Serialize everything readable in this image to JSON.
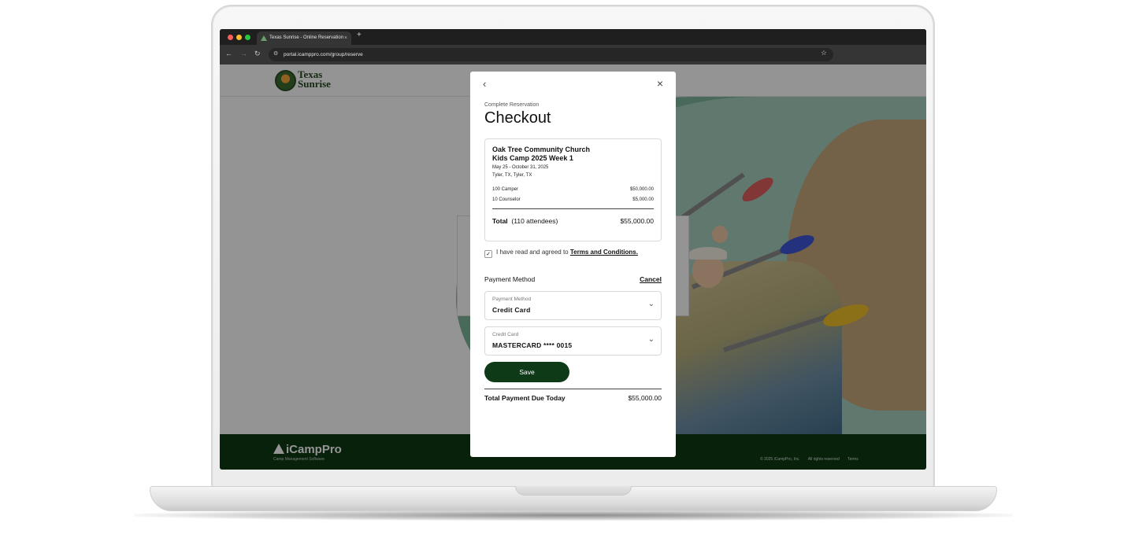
{
  "browser": {
    "tab_title": "Texas Sunrise - Online Reservation",
    "tab_close": "×",
    "new_tab": "+",
    "url": "portal.icamppro.com/group/reserve"
  },
  "site": {
    "logo_line1": "Texas",
    "logo_line2": "Sunrise"
  },
  "modal": {
    "back": "‹",
    "close": "×",
    "subtitle": "Complete Reservation",
    "title": "Checkout",
    "summary": {
      "organization": "Oak Tree Community Church",
      "event": "Kids Camp 2025 Week 1",
      "dates": "May 25 - October 31, 2025",
      "location": "Tyler, TX, Tyler, TX",
      "lines": [
        {
          "label": "100 Camper",
          "amount": "$50,000.00"
        },
        {
          "label": "10 Counselor",
          "amount": "$5,000.00"
        }
      ],
      "total_label": "Total",
      "total_attendees": "(110 attendees)",
      "total_amount": "$55,000.00"
    },
    "agreement": {
      "checked": true,
      "check_glyph": "✓",
      "text": "I have read and agreed to",
      "link": "Terms and Conditions."
    },
    "payment": {
      "heading": "Payment Method",
      "cancel": "Cancel",
      "method_label": "Payment Method",
      "method_value": "Credit Card",
      "card_label": "Credit Card",
      "card_value": "MASTERCARD **** 0015",
      "chevron": "⌄"
    },
    "save_label": "Save",
    "due_label": "Total Payment Due Today",
    "due_amount": "$55,000.00"
  },
  "footer": {
    "brand": "iCampPro",
    "tagline": "Camp Management Software",
    "copyright": "© 2025 iCampPro, Inc.",
    "rights": "All rights reserved",
    "terms": "Terms"
  },
  "colors": {
    "brand_green": "#0f3a17",
    "footer_green": "#0e3a14"
  }
}
